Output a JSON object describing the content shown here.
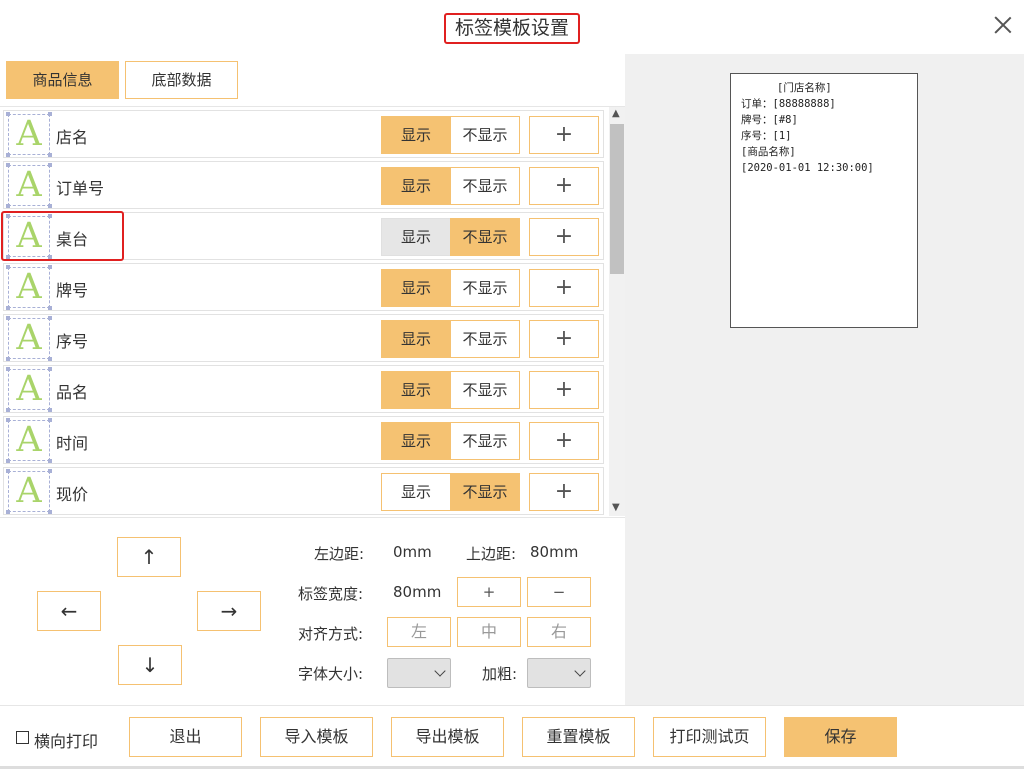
{
  "window": {
    "title": "标签模板设置"
  },
  "tabs": [
    {
      "label": "商品信息",
      "active": true
    },
    {
      "label": "底部数据",
      "active": false
    }
  ],
  "fields": {
    "show_label": "显示",
    "hide_label": "不显示",
    "add_label": "+",
    "icon_glyph": "A",
    "items": [
      {
        "label": "店名",
        "visible": true
      },
      {
        "label": "订单号",
        "visible": true
      },
      {
        "label": "桌台",
        "visible": false,
        "highlighted": true
      },
      {
        "label": "牌号",
        "visible": true
      },
      {
        "label": "序号",
        "visible": true
      },
      {
        "label": "品名",
        "visible": true
      },
      {
        "label": "时间",
        "visible": true
      },
      {
        "label": "现价",
        "visible": false
      }
    ]
  },
  "nav_arrows": {
    "up": "↑",
    "down": "↓",
    "left": "←",
    "right": "→"
  },
  "settings": {
    "left_margin_label": "左边距:",
    "left_margin_value": "0mm",
    "top_margin_label": "上边距:",
    "top_margin_value": "80mm",
    "label_width_label": "标签宽度:",
    "label_width_value": "80mm",
    "width_plus": "+",
    "width_minus": "−",
    "align_label": "对齐方式:",
    "align_left": "左",
    "align_center": "中",
    "align_right": "右",
    "font_size_label": "字体大小:",
    "bold_label": "加粗:"
  },
  "preview": {
    "lines": [
      "[门店名称]",
      "订单：[88888888]",
      "牌号：[#8]",
      "序号：[1]",
      "[商品名称]",
      "[2020-01-01 12:30:00]"
    ]
  },
  "footer": {
    "landscape_label": "横向打印",
    "landscape_checked": false,
    "exit": "退出",
    "import": "导入模板",
    "export": "导出模板",
    "reset": "重置模板",
    "test_print": "打印测试页",
    "save": "保存"
  },
  "colors": {
    "accent": "#f5c272",
    "highlight_border": "#e02020",
    "icon_green": "#a9d46a",
    "panel_bg": "#f0f0f0"
  }
}
